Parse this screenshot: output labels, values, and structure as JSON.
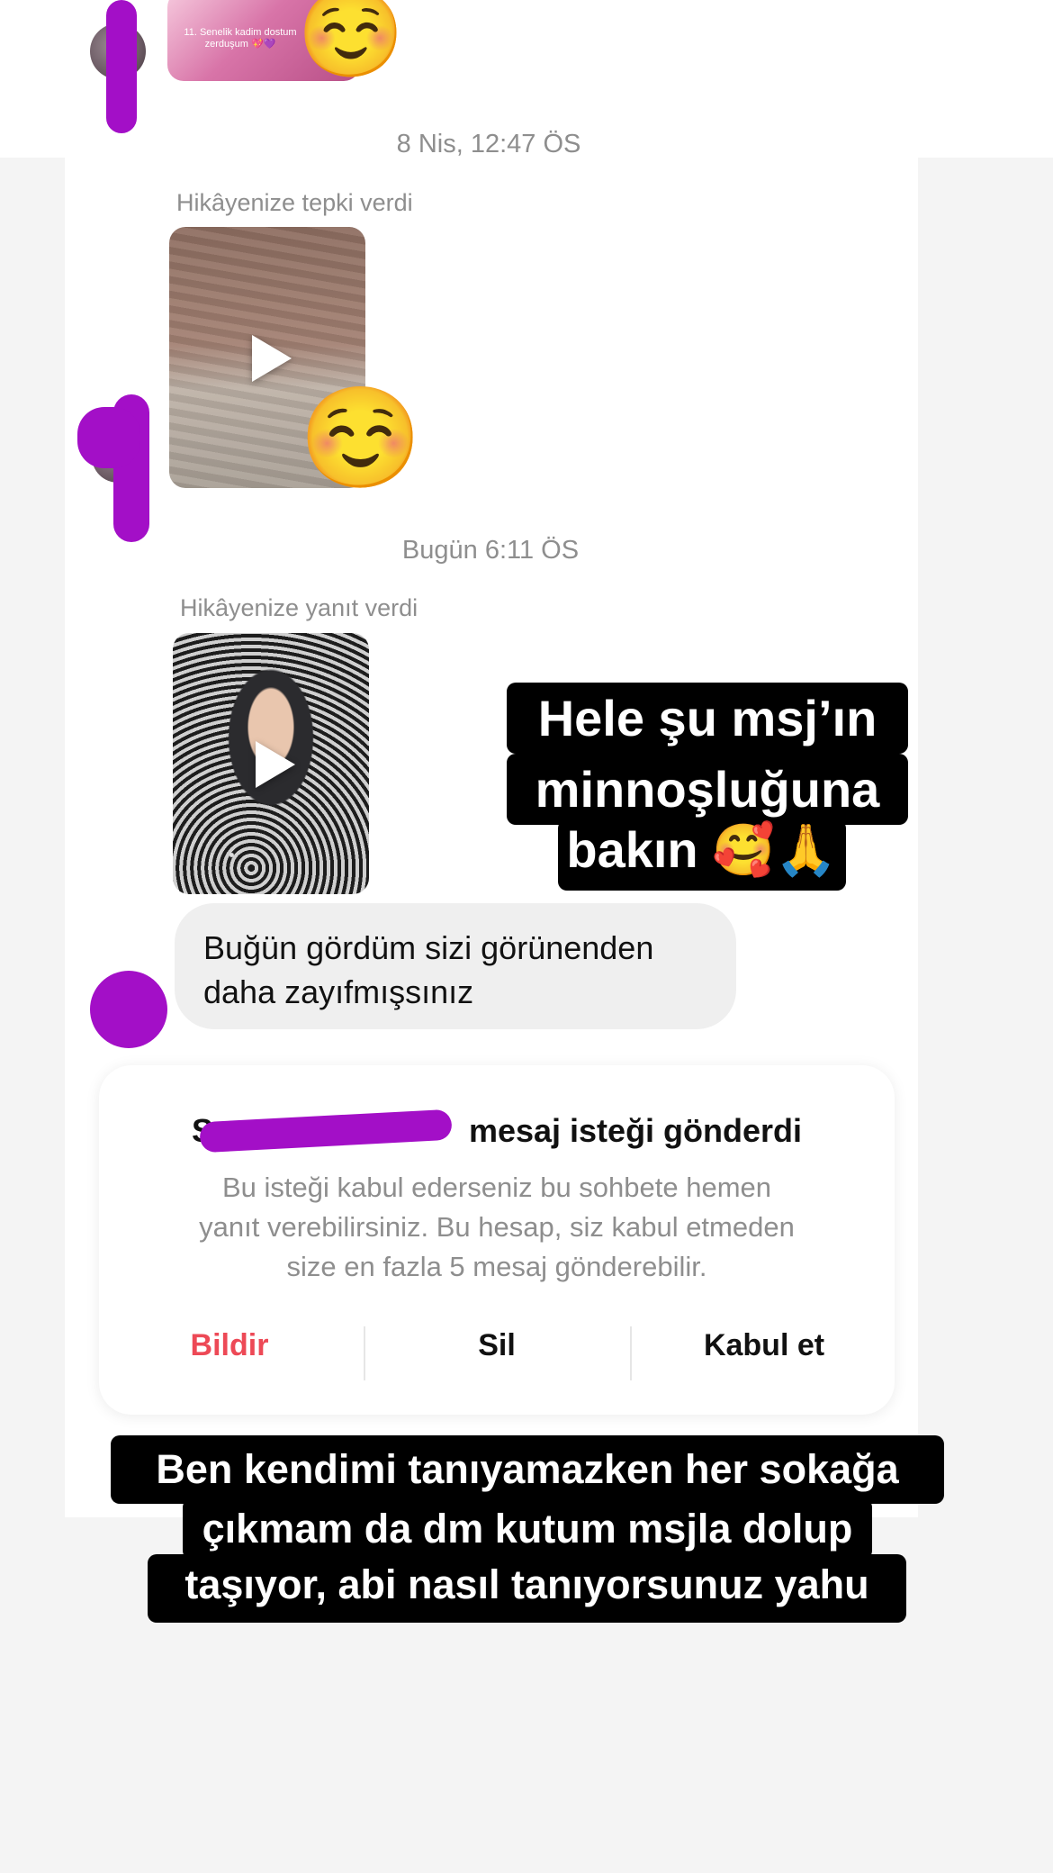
{
  "story_preview_1": {
    "caption": "11. Senelik kadim dostum zerduşum 💖💜",
    "reaction_emoji": "☺️"
  },
  "divider_1": {
    "timestamp": "8 Nis, 12:47 ÖS"
  },
  "reaction_block": {
    "label": "Hikâyenize tepki verdi",
    "reaction_emoji": "☺️"
  },
  "divider_2": {
    "timestamp": "Bugün 6:11 ÖS"
  },
  "reply_block": {
    "label": "Hikâyenize yanıt verdi"
  },
  "message": {
    "text_line1": "Buğün gördüm sizi görünenden",
    "text_line2": "daha zayıfmışsınız"
  },
  "request_card": {
    "title": "Sn mesaj isteği gönderdi",
    "title_visible_prefix": "Sn",
    "title_visible_suffix": "mesaj isteği gönderdi",
    "body_line1": "Bu isteği kabul ederseniz bu sohbete hemen",
    "body_line2": "yanıt verebilirsiniz. Bu hesap, siz kabul etmeden",
    "body_line3": "size en fazla 5 mesaj gönderebilir.",
    "actions": {
      "report": "Bildir",
      "delete": "Sil",
      "accept": "Kabul et"
    },
    "colors": {
      "report": "#ed4956",
      "default": "#111111"
    }
  },
  "caption_top": {
    "line1": "Hele şu msj’ın",
    "line2": "minnoşluğuna",
    "line3": "bakın 🥰🙏"
  },
  "caption_bottom": {
    "line1": "Ben kendimi tanıyamazken her sokağa",
    "line2": "çıkmam da dm kutum msjla dolup",
    "line3": "taşıyor, abi nasıl tanıyorsunuz yahu"
  },
  "colors": {
    "scribble": "#a30fc7",
    "background": "#f4f4f4"
  }
}
